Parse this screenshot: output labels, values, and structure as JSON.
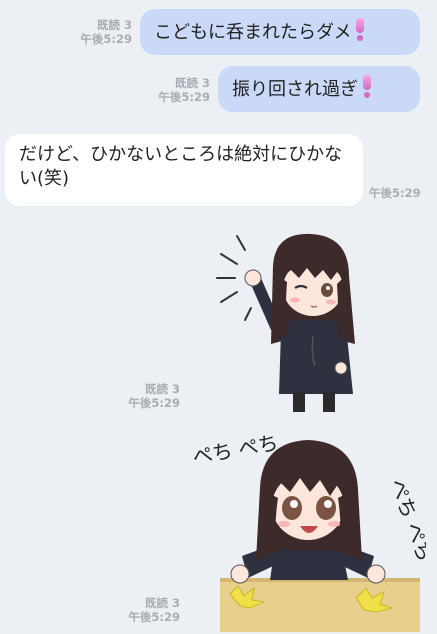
{
  "messages": [
    {
      "text": "こどもに呑まれたらダメ",
      "read": "既読 3",
      "time": "午後5:29",
      "emoji": "pink-exclamation"
    },
    {
      "text": "振り回され過ぎ",
      "read": "既読 3",
      "time": "午後5:29",
      "emoji": "pink-exclamation"
    },
    {
      "text": "だけど、ひかないところは絶対にひかない(笑)",
      "time": "午後5:29"
    }
  ],
  "stickers": [
    {
      "name": "waving-girl-sticker",
      "read": "既読 3",
      "time": "午後5:29"
    },
    {
      "name": "slapping-desk-girl-sticker",
      "read": "既読 3",
      "time": "午後5:29",
      "sfx_left": "ぺち ぺち",
      "sfx_right": "ぺち ぺち"
    }
  ],
  "colors": {
    "outgoing_bubble": "#c9d9f7",
    "incoming_bubble": "#ffffff",
    "background": "#eceff3",
    "meta": "#a9adb3"
  }
}
